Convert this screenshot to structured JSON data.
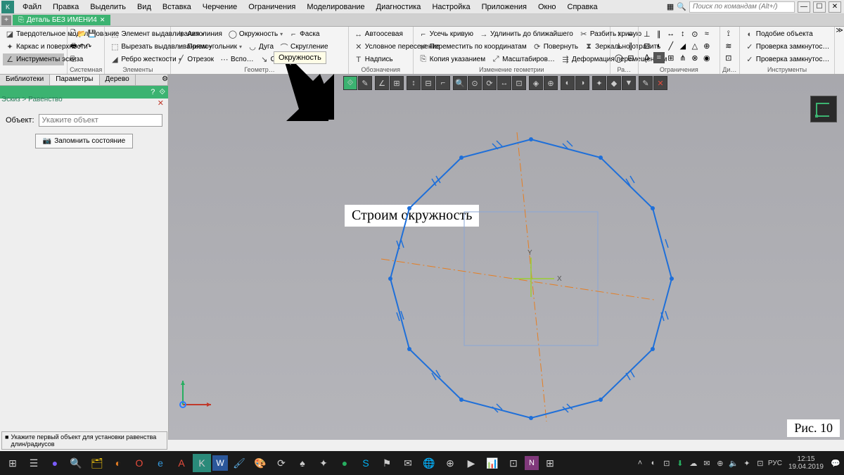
{
  "menu": {
    "items": [
      "Файл",
      "Правка",
      "Выделить",
      "Вид",
      "Вставка",
      "Черчение",
      "Ограничения",
      "Моделирование",
      "Диагностика",
      "Настройка",
      "Приложения",
      "Окно",
      "Справка"
    ],
    "search_placeholder": "Поиск по командам (Alt+/)"
  },
  "document_tab": "Деталь БЕЗ ИМЕНИ4",
  "ribbon": {
    "groups": {
      "sistema": "Системная",
      "elements": "Элементы",
      "geom": "Геометр…",
      "oboz": "Обозначения",
      "izm": "Изменение геометрии",
      "ra": "Ра…",
      "ogr": "Ограничения",
      "di": "Ди…",
      "instr": "Инструменты"
    },
    "col1": {
      "a": "Твердотельное моделирование",
      "b": "Каркас и поверхности",
      "c": "Инструменты эскиза"
    },
    "col3": {
      "a": "Элемент выдавливания",
      "b": "Вырезать выдавливанием",
      "c": "Ребро жесткости"
    },
    "geom": {
      "a": "Автолиния",
      "b": "Окружность",
      "c": "Фаска",
      "d": "Прямоугольник",
      "e": "Дуга",
      "f": "Скругление",
      "g": "Отрезок",
      "h": "Вспо…",
      "i": "Спроецировать"
    },
    "oboz": {
      "a": "Автоосевая",
      "b": "Условное пересечение",
      "c": "Надпись"
    },
    "izm": {
      "a": "Усечь кривую",
      "b": "Удлинить до ближайшего",
      "c": "Разбить кривую",
      "d": "Переместить по координатам",
      "e": "Повернуть",
      "f": "Зеркально отразить",
      "g": "Копия указанием",
      "h": "Масштабиров…",
      "i": "Деформация перемещением"
    },
    "instr": {
      "a": "Подобие объекта",
      "b": "Проверка замкнутос…",
      "c": "Проверка замкнутос…"
    }
  },
  "tooltip": "Окружность",
  "annotation_text": "Строим окружность",
  "fig_label": "Рис. 10",
  "breadcrumb": "Эскиз > Равенство",
  "left_panel": {
    "tabs": [
      "Библиотеки",
      "Параметры",
      "Дерево"
    ],
    "object_label": "Объект:",
    "object_placeholder": "Укажите объект",
    "remember_btn": "Запомнить состояние"
  },
  "status_text": "Укажите первый объект для установки равенства длин/радиусов",
  "taskbar": {
    "lang": "РУС",
    "time": "12:15",
    "date": "19.04.2019"
  }
}
